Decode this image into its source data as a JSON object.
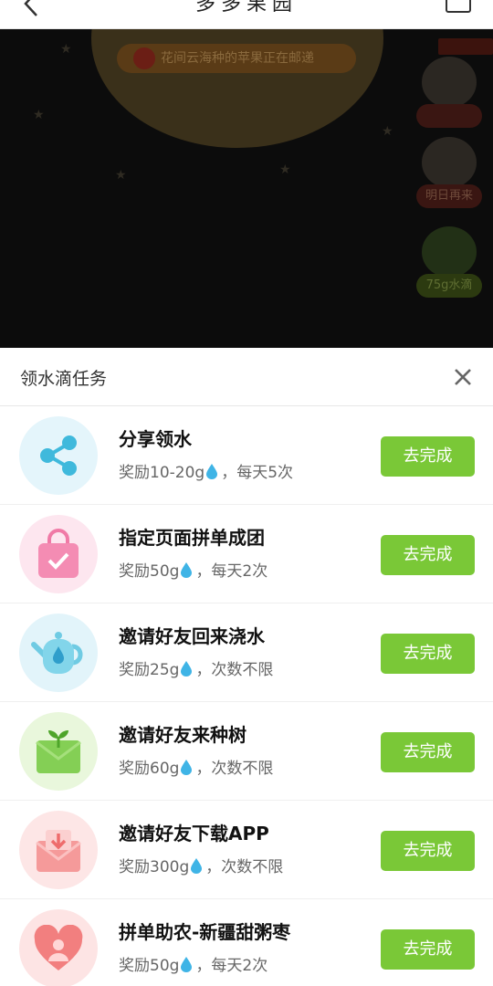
{
  "app": {
    "title": "多多果园"
  },
  "scene": {
    "notice": "花间云海种的苹果正在邮递",
    "widgets": [
      {
        "label": ""
      },
      {
        "label": "明日再来"
      },
      {
        "label": "75g水滴"
      }
    ]
  },
  "sheet": {
    "title": "领水滴任务",
    "tasks": [
      {
        "name": "分享领水",
        "reward_prefix": "奖励10-20g",
        "reward_suffix": "，每天5次",
        "button": "去完成",
        "icon": "share-icon",
        "icon_bg": "#e4f5fb"
      },
      {
        "name": "指定页面拼单成团",
        "reward_prefix": "奖励50g",
        "reward_suffix": "，每天2次",
        "button": "去完成",
        "icon": "shopping-bag-icon",
        "icon_bg": "#fde6ef"
      },
      {
        "name": "邀请好友回来浇水",
        "reward_prefix": "奖励25g",
        "reward_suffix": "，次数不限",
        "button": "去完成",
        "icon": "watering-can-icon",
        "icon_bg": "#e2f4fa"
      },
      {
        "name": "邀请好友来种树",
        "reward_prefix": "奖励60g",
        "reward_suffix": "，次数不限",
        "button": "去完成",
        "icon": "sprout-envelope-icon",
        "icon_bg": "#e9f7dc"
      },
      {
        "name": "邀请好友下载APP",
        "reward_prefix": "奖励300g",
        "reward_suffix": "，次数不限",
        "button": "去完成",
        "icon": "download-envelope-icon",
        "icon_bg": "#fde6e6"
      },
      {
        "name": "拼单助农-新疆甜粥枣",
        "reward_prefix": "奖励50g",
        "reward_suffix": "，每天2次",
        "button": "去完成",
        "icon": "heart-person-icon",
        "icon_bg": "#fde4e4"
      }
    ]
  },
  "colors": {
    "accent_button": "#7ac837",
    "water_drop": "#3fb4e6"
  }
}
